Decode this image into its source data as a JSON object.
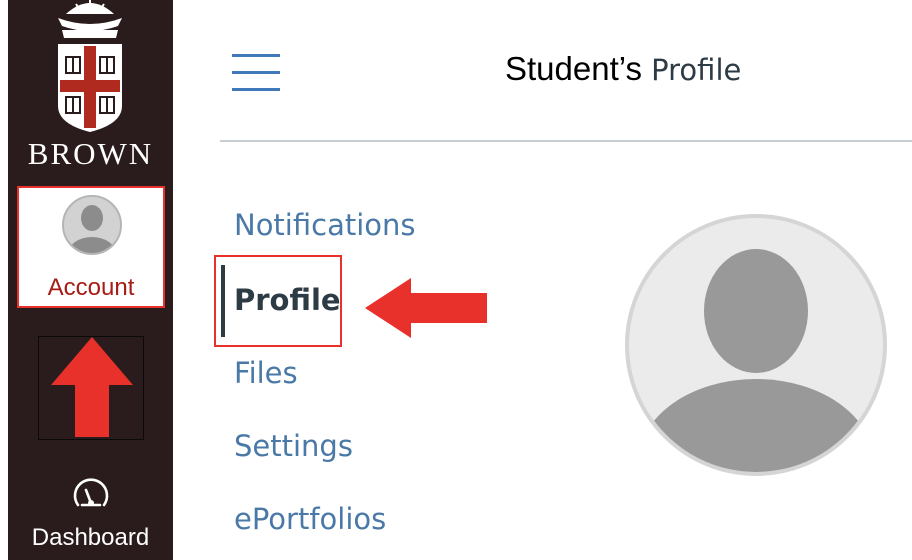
{
  "global_nav": {
    "brand": "BROWN",
    "account_label": "Account",
    "dashboard_label": "Dashboard"
  },
  "header": {
    "title_prefix": "Student’s",
    "title_main": "Profile"
  },
  "subnav": {
    "items": [
      {
        "label": "Notifications",
        "active": false
      },
      {
        "label": "Profile",
        "active": true
      },
      {
        "label": "Files",
        "active": false
      },
      {
        "label": "Settings",
        "active": false
      },
      {
        "label": "ePortfolios",
        "active": false
      }
    ]
  },
  "colors": {
    "nav_background": "#2a1c1c",
    "link_blue": "#4a79a7",
    "annotation_red": "#e8312b",
    "account_text": "#a51c14",
    "active_text": "#2d3b45"
  },
  "icons": [
    "brown-university-logo",
    "hamburger-icon",
    "user-avatar-icon",
    "dashboard-speedometer-icon",
    "up-arrow-annotation",
    "left-arrow-annotation"
  ]
}
